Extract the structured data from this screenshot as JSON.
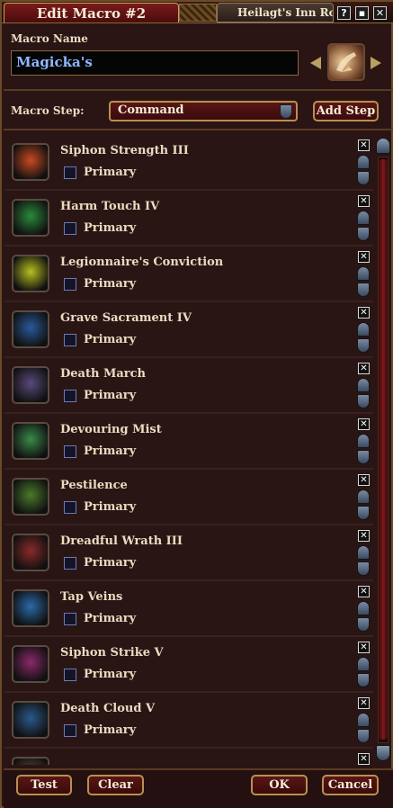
{
  "window": {
    "tab_active": "Edit Macro #2",
    "tab_inactive": "Heilagt's Inn Ro",
    "help_icon": "question-icon",
    "restore_icon": "restore-icon",
    "close_icon": "close-icon"
  },
  "macro": {
    "name_label": "Macro Name",
    "name_value": "Magicka's",
    "icon": "hand-icon"
  },
  "step": {
    "label": "Macro Step:",
    "selected": "Command",
    "add_button": "Add Step"
  },
  "steps": [
    {
      "name": "Siphon Strength III",
      "primary": "Primary",
      "icon": "siphon-strength-icon",
      "color": "#c84a20"
    },
    {
      "name": "Harm Touch IV",
      "primary": "Primary",
      "icon": "harm-touch-icon",
      "color": "#2a8a3a"
    },
    {
      "name": "Legionnaire's Conviction",
      "primary": "Primary",
      "icon": "conviction-icon",
      "color": "#b8c020"
    },
    {
      "name": "Grave Sacrament IV",
      "primary": "Primary",
      "icon": "grave-sacrament-icon",
      "color": "#2a5a9a"
    },
    {
      "name": "Death March",
      "primary": "Primary",
      "icon": "death-march-icon",
      "color": "#5a4a7a"
    },
    {
      "name": "Devouring Mist",
      "primary": "Primary",
      "icon": "devouring-mist-icon",
      "color": "#3a8a4a"
    },
    {
      "name": "Pestilence",
      "primary": "Primary",
      "icon": "skull-icon",
      "color": "#4a7a2a"
    },
    {
      "name": "Dreadful Wrath III",
      "primary": "Primary",
      "icon": "dreadful-wrath-icon",
      "color": "#8a2a2a"
    },
    {
      "name": "Tap Veins",
      "primary": "Primary",
      "icon": "heart-icon",
      "color": "#2a6aaa"
    },
    {
      "name": "Siphon Strike V",
      "primary": "Primary",
      "icon": "siphon-strike-icon",
      "color": "#8a2a6a"
    },
    {
      "name": "Death Cloud V",
      "primary": "Primary",
      "icon": "death-cloud-icon",
      "color": "#2a5a8a"
    },
    {
      "name": "",
      "primary": "",
      "icon": "partial-step-icon",
      "color": "#5a4a40"
    }
  ],
  "footer": {
    "test": "Test",
    "clear": "Clear",
    "ok": "OK",
    "cancel": "Cancel"
  }
}
